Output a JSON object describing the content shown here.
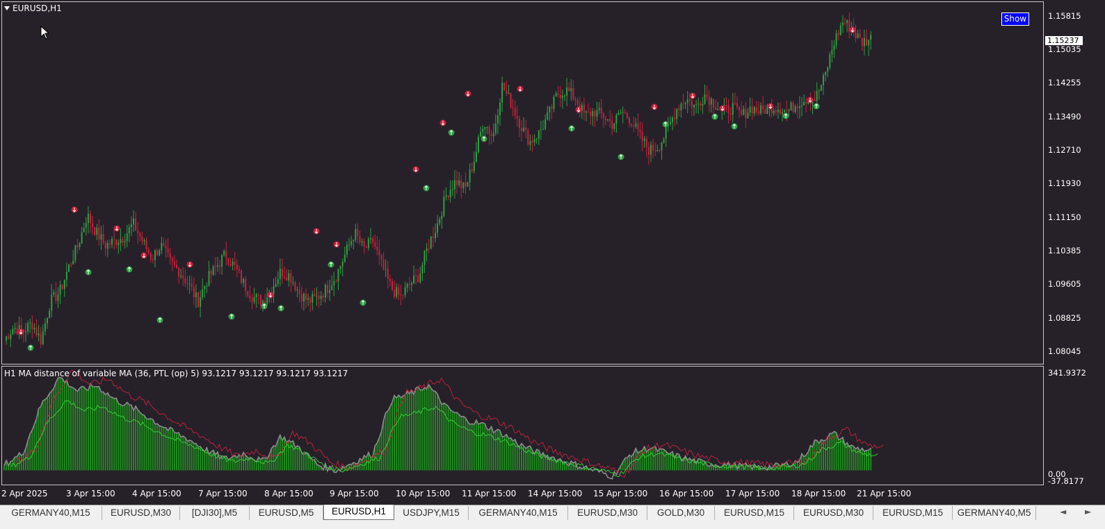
{
  "chart": {
    "title": "EURUSD,H1",
    "show_button": "Show",
    "current_price": "1.15237",
    "price_axis": [
      "1.15815",
      "1.15035",
      "1.14255",
      "1.13490",
      "1.12710",
      "1.11930",
      "1.11150",
      "1.10385",
      "1.09605",
      "1.08825",
      "1.08045"
    ],
    "indicator_title": "H1 MA distance of variable MA (36, PTL (op) 5) 93.1217 93.1217 93.1217 93.1217",
    "indicator_axis": [
      "341.9372",
      "0.00",
      "-37.8177"
    ],
    "time_axis": [
      "2 Apr 2025",
      "3 Apr 15:00",
      "4 Apr 15:00",
      "7 Apr 15:00",
      "8 Apr 15:00",
      "9 Apr 15:00",
      "10 Apr 15:00",
      "11 Apr 15:00",
      "14 Apr 15:00",
      "15 Apr 15:00",
      "16 Apr 15:00",
      "17 Apr 15:00",
      "18 Apr 15:00",
      "21 Apr 15:00"
    ]
  },
  "chart_data": {
    "type": "line",
    "symbol": "EURUSD",
    "timeframe": "H1",
    "ylim": [
      1.08045,
      1.15815
    ],
    "close_path": [
      1.083,
      1.086,
      1.085,
      1.087,
      1.083,
      1.092,
      1.094,
      1.1,
      1.105,
      1.112,
      1.108,
      1.105,
      1.106,
      1.107,
      1.11,
      1.106,
      1.102,
      1.105,
      1.101,
      1.099,
      1.096,
      1.092,
      1.097,
      1.1,
      1.103,
      1.1,
      1.096,
      1.093,
      1.092,
      1.095,
      1.099,
      1.098,
      1.094,
      1.092,
      1.093,
      1.095,
      1.098,
      1.103,
      1.108,
      1.104,
      1.106,
      1.1,
      1.095,
      1.093,
      1.096,
      1.098,
      1.105,
      1.11,
      1.117,
      1.12,
      1.118,
      1.125,
      1.134,
      1.13,
      1.142,
      1.138,
      1.133,
      1.129,
      1.131,
      1.135,
      1.14,
      1.141,
      1.139,
      1.135,
      1.136,
      1.135,
      1.133,
      1.136,
      1.134,
      1.13,
      1.127,
      1.128,
      1.132,
      1.137,
      1.139,
      1.137,
      1.14,
      1.138,
      1.136,
      1.137,
      1.135,
      1.137,
      1.136,
      1.137,
      1.137,
      1.136,
      1.138,
      1.139,
      1.139,
      1.144,
      1.152,
      1.157,
      1.155,
      1.152,
      1.153
    ],
    "indicator": {
      "name": "H1 MA distance of variable MA",
      "values": [
        93.1217,
        93.1217,
        93.1217,
        93.1217
      ],
      "ylim": [
        -37.8177,
        341.9372
      ]
    },
    "colors": {
      "background": "#262129",
      "bull": "#2f9e44",
      "bear": "#c8203c",
      "histogram": "#1f8c1f",
      "signal_line": "#39d439",
      "price_line": "#8a8a8a",
      "red_line": "#c8203c"
    }
  },
  "tabs": [
    "GERMANY40,M15",
    "EURUSD,M30",
    "[DJI30],M5",
    "EURUSD,M5",
    "EURUSD,H1",
    "USDJPY,M15",
    "GERMANY40,M15",
    "EURUSD,M30",
    "GOLD,M30",
    "EURUSD,M15",
    "EURUSD,M30",
    "EURUSD,M15",
    "GERMANY40,M5"
  ],
  "active_tab": "EURUSD,H1",
  "tab_nav": {
    "prev": "◄",
    "next": "►"
  }
}
